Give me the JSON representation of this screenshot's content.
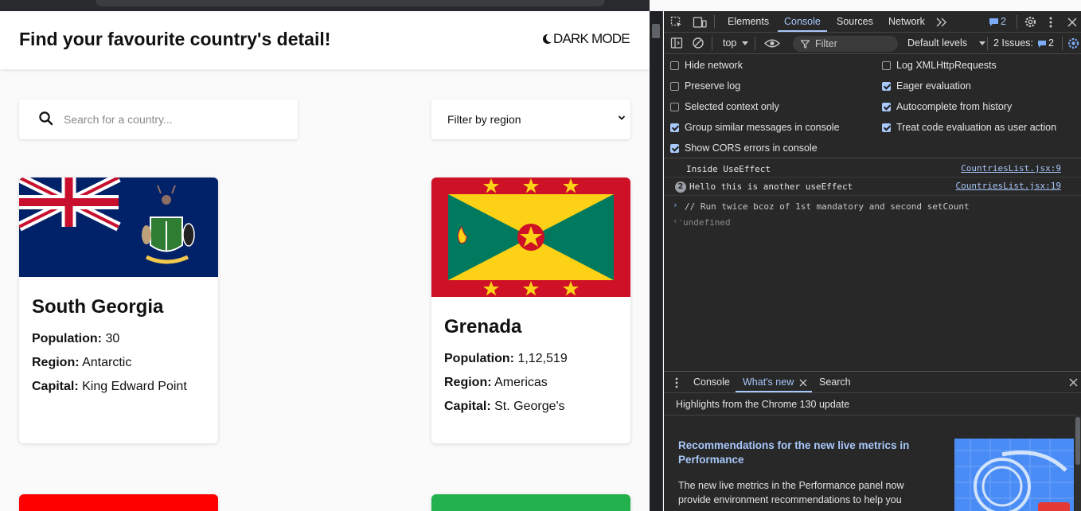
{
  "page": {
    "title": "Find your favourite country's detail!",
    "dark_mode_label": "DARK MODE",
    "search": {
      "placeholder": "Search for a country..."
    },
    "region_filter": {
      "selected": "Filter by region"
    },
    "labels": {
      "population": "Population:",
      "region": "Region:",
      "capital": "Capital:"
    },
    "countries": [
      {
        "name": "South Georgia",
        "population": "30",
        "region": "Antarctic",
        "capital": "King Edward Point"
      },
      {
        "name": "Grenada",
        "population": "1,12,519",
        "region": "Americas",
        "capital": "St. George's"
      }
    ]
  },
  "devtools": {
    "tabs": [
      "Elements",
      "Console",
      "Sources",
      "Network"
    ],
    "active_tab": "Console",
    "issues_badge": "2",
    "toolbar": {
      "context": "top",
      "filter_placeholder": "Filter",
      "levels": "Default levels",
      "issues_label": "2 Issues:",
      "issues_count": "2"
    },
    "settings_left": [
      {
        "label": "Hide network",
        "checked": false
      },
      {
        "label": "Preserve log",
        "checked": false
      },
      {
        "label": "Selected context only",
        "checked": false
      },
      {
        "label": "Group similar messages in console",
        "checked": true
      },
      {
        "label": "Show CORS errors in console",
        "checked": true
      }
    ],
    "settings_right": [
      {
        "label": "Log XMLHttpRequests",
        "checked": false
      },
      {
        "label": "Eager evaluation",
        "checked": true
      },
      {
        "label": "Autocomplete from history",
        "checked": true
      },
      {
        "label": "Treat code evaluation as user action",
        "checked": true
      }
    ],
    "messages": [
      {
        "text": "Inside UseEffect",
        "source": "CountriesList.jsx:9"
      },
      {
        "count": "2",
        "text": "Hello this is another useEffect",
        "source": "CountriesList.jsx:19"
      }
    ],
    "input_line": "// Run twice bcoz of 1st mandatory and second setCount",
    "result_line": "undefined",
    "drawer": {
      "tabs": [
        "Console",
        "What's new",
        "Search"
      ],
      "active_tab": "What's new",
      "heading": "Highlights from the Chrome 130 update",
      "rec_title": "Recommendations for the new live metrics in Performance",
      "rec_body": "The new live metrics in the Performance panel now provide environment recommendations to help you"
    }
  }
}
